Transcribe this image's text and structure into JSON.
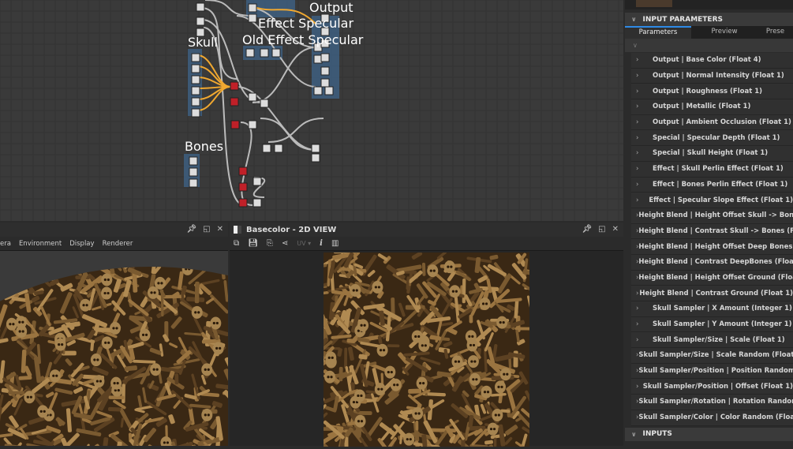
{
  "graph": {
    "frames": [
      "Output",
      "Effect Specular",
      "Old Effect Specular",
      "Skull",
      "Bones"
    ]
  },
  "view3d": {
    "menu": [
      "era",
      "Environment",
      "Display",
      "Renderer"
    ],
    "icons": [
      "pin-icon",
      "maximize-icon",
      "close-icon"
    ]
  },
  "view2d": {
    "title": "Basecolor - 2D VIEW",
    "uv_label": "UV",
    "info_label": "i",
    "icons": [
      "pin-icon",
      "maximize-icon",
      "close-icon"
    ]
  },
  "right": {
    "section_title": "INPUT PARAMETERS",
    "tabs": [
      "Parameters",
      "Preview",
      "Prese"
    ],
    "params": [
      "Output | Base Color (Float 4)",
      "Output | Normal Intensity (Float 1)",
      "Output | Roughness (Float 1)",
      "Output | Metallic (Float 1)",
      "Output | Ambient Occlusion (Float 1)",
      "Special | Specular Depth (Float 1)",
      "Special | Skull Height (Float 1)",
      "Effect | Skull Perlin Effect (Float 1)",
      "Effect | Bones Perlin Effect (Float 1)",
      "Effect | Specular Slope Effect (Float 1)",
      "Height Blend | Height Offset Skull -> Bones",
      "Height Blend | Contrast Skull -> Bones (Float",
      "Height Blend | Height Offset Deep Bones (Fl",
      "Height Blend | Contrast DeepBones (Float 1",
      "Height Blend | Height Offset Ground (Float 1",
      "Height Blend | Contrast Ground (Float 1)",
      "Skull Sampler | X Amount (Integer 1)",
      "Skull Sampler | Y Amount (Integer 1)",
      "Skull Sampler/Size | Scale (Float 1)",
      "Skull Sampler/Size | Scale Random (Float 1",
      "Skull Sampler/Position | Position Random (",
      "Skull Sampler/Position | Offset (Float 1)",
      "Skull Sampler/Rotation | Rotation Random",
      "Skull Sampler/Color | Color Random (Float"
    ],
    "inputs_title": "INPUTS"
  },
  "colors": {
    "accent": "#2e8ae6",
    "wire_orange": "#f0a830",
    "frame": "#3e5f80"
  }
}
